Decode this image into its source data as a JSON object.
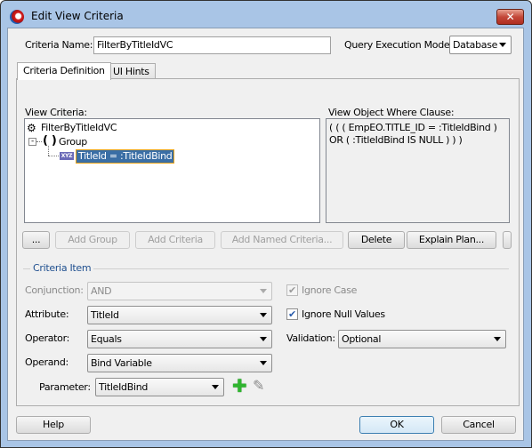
{
  "window": {
    "title": "Edit View Criteria",
    "close_glyph": "✕"
  },
  "criteria_name": {
    "label": "Criteria Name:",
    "value": "FilterByTitleIdVC"
  },
  "query_mode": {
    "label": "Query Execution Mode:",
    "value": "Database"
  },
  "tabs": [
    {
      "label": "Criteria Definition",
      "active": true
    },
    {
      "label": "UI Hints",
      "active": false
    }
  ],
  "view_criteria": {
    "label": "View Criteria:",
    "tree": {
      "root": "FilterByTitleIdVC",
      "group": "Group",
      "group_glyph": "( )",
      "item_icon_text": "XYZ",
      "item": "TitleId = :TitleIdBind"
    }
  },
  "where_clause": {
    "label": "View Object Where Clause:",
    "lines": [
      "( ( ( EmpEO.TITLE_ID = :TitleIdBind  )",
      "OR  ( :TitleIdBind IS NULL ) ) )"
    ]
  },
  "toolbar": {
    "more": "...",
    "add_group": "Add Group",
    "add_criteria": "Add Criteria",
    "add_named": "Add Named Criteria...",
    "delete": "Delete",
    "explain": "Explain Plan..."
  },
  "criteria_item": {
    "legend": "Criteria Item",
    "conjunction": {
      "label": "Conjunction:",
      "value": "AND",
      "enabled": false
    },
    "attribute": {
      "label": "Attribute:",
      "value": "TitleId"
    },
    "operator": {
      "label": "Operator:",
      "value": "Equals"
    },
    "operand": {
      "label": "Operand:",
      "value": "Bind Variable"
    },
    "parameter": {
      "label": "Parameter:",
      "value": "TitleIdBind"
    },
    "ignore_case": {
      "label": "Ignore Case",
      "checked": true,
      "enabled": false
    },
    "ignore_null": {
      "label": "Ignore Null Values",
      "checked": true
    },
    "validation": {
      "label": "Validation:",
      "value": "Optional"
    }
  },
  "footer": {
    "help": "Help",
    "ok": "OK",
    "cancel": "Cancel"
  },
  "colors": {
    "selection": "#3a6ea5",
    "selection_border": "#e8a317",
    "legend_text": "#1f4f8f",
    "add_icon": "#2fb52f"
  }
}
